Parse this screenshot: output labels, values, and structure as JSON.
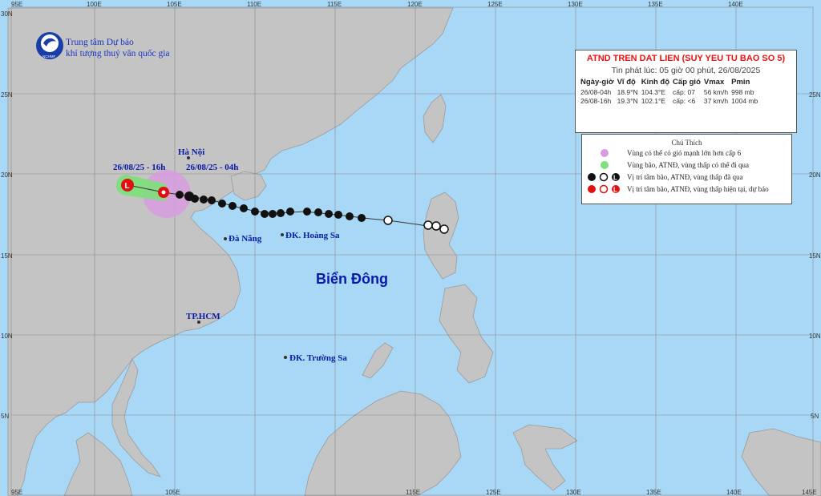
{
  "org": {
    "line1": "Trung tâm Dự báo",
    "line2": "khí tượng thuỷ văn quốc gia",
    "logo_text": "NCHMF"
  },
  "axes": {
    "lon_top": [
      "95E",
      "100E",
      "105E",
      "110E",
      "115E",
      "120E",
      "125E",
      "130E",
      "135E",
      "140E"
    ],
    "lon_bottom": [
      "95E",
      "105E",
      "115E",
      "125E",
      "130E",
      "135E",
      "140E",
      "145E"
    ],
    "lat_left": [
      "30N",
      "25N",
      "20N",
      "15N",
      "10N",
      "5N"
    ],
    "lat_right": [
      "25N",
      "20N",
      "15N",
      "10N",
      "5N"
    ]
  },
  "places": {
    "hanoi": "Hà Nội",
    "danang": "Đà Nẵng",
    "hoangsa": "ĐK. Hoàng Sa",
    "hcm": "TP.HCM",
    "truongsa": "ĐK. Trường Sa",
    "sea": "Biển Đông"
  },
  "track_labels": {
    "forecast": "26/08/25 - 16h",
    "current": "26/08/25 - 04h"
  },
  "info": {
    "title": "ATND TREN DAT LIEN (SUY YEU TU BAO SO 5)",
    "issued": "Tin phát lúc: 05 giờ 00 phút, 26/08/2025",
    "headers": [
      "Ngày-giờ",
      "Vĩ độ",
      "Kinh độ",
      "Cấp gió",
      "Vmax",
      "Pmin"
    ],
    "rows": [
      [
        "26/08-04h",
        "18.9°N",
        "104.3°E",
        "cấp: 07",
        "56 km/h",
        "998 mb"
      ],
      [
        "26/08-16h",
        "19.3°N",
        "102.1°E",
        "cấp: <6",
        "37 km/h",
        "1004 mb"
      ]
    ]
  },
  "legend": {
    "title": "Chú Thích",
    "items": [
      {
        "text": "Vùng có thể có gió mạnh lớn hơn cấp 6",
        "color": "#d89ce0"
      },
      {
        "text": "Vùng bão, ATNĐ, vùng thấp có thể đi qua",
        "color": "#7de07a"
      },
      {
        "text": "Vị trí tâm bão, ATNĐ, vùng thấp đã qua",
        "color": "#111111"
      },
      {
        "text": "Vị trí tâm bão, ATNĐ, vùng thấp hiện tại, dự báo",
        "color": "#e01010"
      }
    ]
  },
  "colors": {
    "sea": "#a9d8f7",
    "land": "#c4c4c4",
    "wind_zone": "#d89ce0",
    "forecast_cone": "#7de07a",
    "current": "#e01010",
    "label_blue": "#0a1aa8"
  }
}
